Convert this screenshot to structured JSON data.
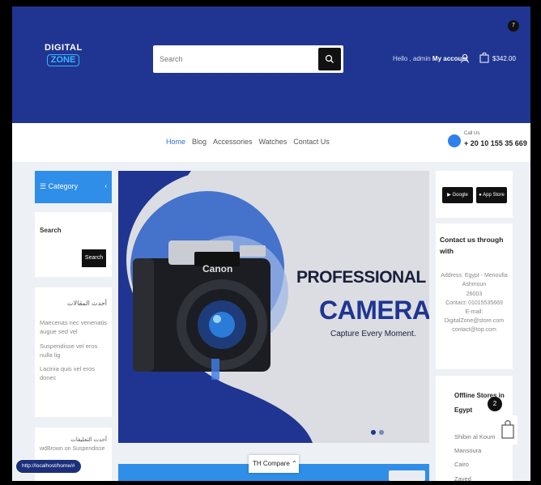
{
  "header": {
    "logo_line1": "DIGITAL",
    "logo_line2": "ZONE",
    "search_placeholder": "Search",
    "greeting": "Hello , admin",
    "account_label": "My account",
    "cart_amount": "$342.00",
    "cart_count": "7"
  },
  "nav": {
    "items": [
      "Home",
      "Blog",
      "Accessories",
      "Watches",
      "Contact Us"
    ],
    "call_label": "Call Us",
    "phone": "+ 20 10 155 35 669"
  },
  "sidebar": {
    "category_label": "Category",
    "search_title": "Search",
    "search_button": "Search",
    "recent_title": "أحدث المقالات",
    "recent_items": [
      "Maecenas nec venenatis augue sed vel",
      "Suspendisse vel eros nulla lig",
      "Lacinia quis vel eros donec"
    ],
    "recent2_title": "أحدث التعليقات",
    "recent2_item": "wdBrown on Suspendisse"
  },
  "hero": {
    "brand": "Canon",
    "title_line1": "PROFESSIONAL",
    "title_line2": "CAMERA",
    "subtitle": "Capture Every Moment."
  },
  "right": {
    "google_play": "Google Play",
    "app_store": "App Store",
    "contact_title": "Contact us through with",
    "contact_lines": [
      "Address: Egypt - Menoufia",
      "Ashmoun",
      "26003",
      "Contact: 01015535669",
      "E-mail:",
      "DigitalZone@store.com",
      "contact@top.com"
    ],
    "offline_title": "Offline Stores in Egypt",
    "offline_items": [
      "Shibin al Koum",
      "Mansoura",
      "Cairo",
      "Zayed"
    ],
    "float_count": "2"
  },
  "bottom": {
    "compare_label": "TH Compare",
    "status_url": "http://localhost/home/#"
  },
  "colors": {
    "header_blue": "#1f3591",
    "accent_blue": "#2f8ee8",
    "dark": "#111111"
  }
}
